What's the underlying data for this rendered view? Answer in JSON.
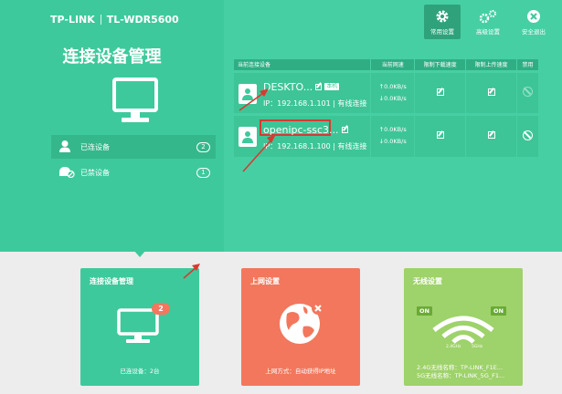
{
  "brand": {
    "logo": "TP-LINK",
    "model": "TL-WDR5600"
  },
  "page_title": "连接设备管理",
  "top_nav": [
    {
      "label": "常用设置",
      "icon": "gear-icon",
      "active": true
    },
    {
      "label": "高级设置",
      "icon": "gears-icon",
      "active": false
    },
    {
      "label": "安全退出",
      "icon": "close-icon",
      "active": false
    }
  ],
  "sidebar": {
    "items": [
      {
        "label": "已连设备",
        "count": "2",
        "icon": "user-icon",
        "active": true
      },
      {
        "label": "已禁设备",
        "count": "1",
        "icon": "blocked-device-icon",
        "active": false
      }
    ]
  },
  "device_table": {
    "headers": [
      "当前连接设备",
      "当前网速",
      "限制下载速度",
      "限制上传速度",
      "禁用"
    ],
    "rows": [
      {
        "name": "DESKTO...",
        "badge": "本机",
        "ip": "IP：192.168.1.101 | 有线连接",
        "up": "↑0.0KB/s",
        "down": "↓0.0KB/s",
        "ban_enabled": false
      },
      {
        "name": "openipc-ssc3...",
        "badge": "",
        "ip": "IP：192.168.1.100 | 有线连接",
        "up": "↑0.0KB/s",
        "down": "↓0.0KB/s",
        "ban_enabled": true
      }
    ]
  },
  "cards": [
    {
      "title": "连接设备管理",
      "footer": "已连设备：2台",
      "badge": "2",
      "color": "#3ec99c"
    },
    {
      "title": "上网设置",
      "footer": "上网方式：自动获得IP地址",
      "color": "#f2775d"
    },
    {
      "title": "无线设置",
      "on_left": "ON",
      "on_right": "ON",
      "band_24": "2.4GHz",
      "band_5": "5GHz",
      "footer_line1": "2.4G无线名称：TP-LINK_F1E...",
      "footer_line2": "5G无线名称：TP-LINK_5G_F1...",
      "color": "#9ed26a"
    }
  ],
  "colors": {
    "primary": "#3ec99c",
    "highlight": "#d73a32",
    "orange": "#f2775d",
    "green_light": "#9ed26a"
  }
}
